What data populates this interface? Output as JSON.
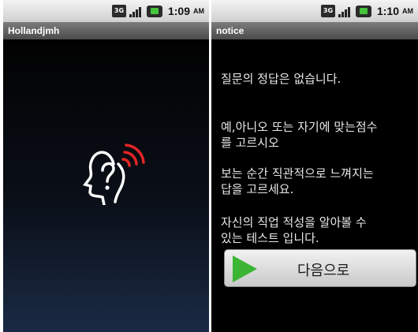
{
  "left_screen": {
    "status_bar": {
      "network": "3G",
      "time": "1:09",
      "ampm": "AM"
    },
    "title": "Hollandjmh",
    "accent_color": "#e22626"
  },
  "right_screen": {
    "status_bar": {
      "network": "3G",
      "time": "1:10",
      "ampm": "AM"
    },
    "title": "notice",
    "lines": [
      "질문의 정답은 없습니다.",
      "예,아니오 또는 자기에 맞는점수\n를 고르시오",
      "보는 순간 직관적으로 느껴지는\n답을  고르세요.",
      "자신의 직업 적성을 알아볼 수\n있는 테스트 입니다."
    ],
    "next_button": {
      "label": "다음으로",
      "icon": "play-icon",
      "icon_color": "#3cb534"
    }
  },
  "icons": [
    "3g-icon",
    "signal-icon",
    "battery-icon",
    "head-question-icon",
    "play-icon"
  ]
}
